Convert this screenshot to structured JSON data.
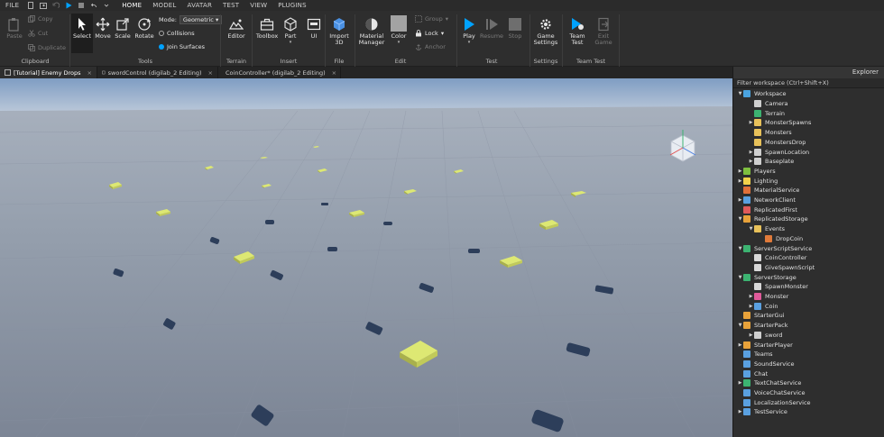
{
  "menu": {
    "file": "FILE",
    "tabs": [
      "HOME",
      "MODEL",
      "AVATAR",
      "TEST",
      "VIEW",
      "PLUGINS"
    ]
  },
  "ribbon": {
    "clipboard": {
      "paste": "Paste",
      "copy": "Copy",
      "cut": "Cut",
      "duplicate": "Duplicate"
    },
    "tools": {
      "select": "Select",
      "move": "Move",
      "scale": "Scale",
      "rotate": "Rotate",
      "mode_label": "Mode:",
      "mode_value": "Geometric",
      "collisions": "Collisions",
      "join_surfaces": "Join Surfaces"
    },
    "terrain": {
      "editor": "Editor"
    },
    "insert": {
      "toolbox": "Toolbox",
      "part": "Part",
      "ui": "UI"
    },
    "file": {
      "import3d_line1": "Import",
      "import3d_line2": "3D"
    },
    "edit": {
      "material_line1": "Material",
      "material_line2": "Manager",
      "color": "Color",
      "group": "Group",
      "lock": "Lock",
      "anchor": "Anchor"
    },
    "test": {
      "play": "Play",
      "resume": "Resume",
      "stop": "Stop"
    },
    "settings": {
      "game_line1": "Game",
      "game_line2": "Settings"
    },
    "teamtest": {
      "team_line1": "Team",
      "team_line2": "Test",
      "exit_line1": "Exit",
      "exit_line2": "Game"
    },
    "groups": {
      "clipboard": "Clipboard",
      "tools": "Tools",
      "terrain": "Terrain",
      "insert": "Insert",
      "file": "File",
      "edit": "Edit",
      "test": "Test",
      "settings": "Settings",
      "team_test": "Team Test"
    }
  },
  "doc_tabs": [
    "[Tutorial] Enemy Drops",
    "swordControl (digilab_2 Editing)",
    "CoinController* (digilab_2 Editing)"
  ],
  "explorer": {
    "title": "Explorer",
    "filter_placeholder": "Filter workspace (Ctrl+Shift+X)",
    "items": [
      {
        "label": "Workspace",
        "level": 0,
        "arrow": "open",
        "icon": "globe-icon",
        "color": "#4aa3df"
      },
      {
        "label": "Camera",
        "level": 1,
        "arrow": "none",
        "icon": "camera-icon",
        "color": "#cfcfcf"
      },
      {
        "label": "Terrain",
        "level": 1,
        "arrow": "none",
        "icon": "terrain-icon",
        "color": "#3cb371"
      },
      {
        "label": "MonsterSpawns",
        "level": 1,
        "arrow": "closed",
        "icon": "folder-icon",
        "color": "#e8c15a"
      },
      {
        "label": "Monsters",
        "level": 1,
        "arrow": "none",
        "icon": "folder-icon",
        "color": "#e8c15a"
      },
      {
        "label": "MonstersDrop",
        "level": 1,
        "arrow": "none",
        "icon": "folder-icon",
        "color": "#e8c15a"
      },
      {
        "label": "SpawnLocation",
        "level": 1,
        "arrow": "closed",
        "icon": "gear-icon",
        "color": "#cfcfcf"
      },
      {
        "label": "Baseplate",
        "level": 1,
        "arrow": "closed",
        "icon": "box-icon",
        "color": "#cfcfcf"
      },
      {
        "label": "Players",
        "level": 0,
        "arrow": "closed",
        "icon": "players-icon",
        "color": "#7fbf3f"
      },
      {
        "label": "Lighting",
        "level": 0,
        "arrow": "closed",
        "icon": "lightbulb-icon",
        "color": "#f2d24b"
      },
      {
        "label": "MaterialService",
        "level": 0,
        "arrow": "none",
        "icon": "material-icon",
        "color": "#e0703a"
      },
      {
        "label": "NetworkClient",
        "level": 0,
        "arrow": "closed",
        "icon": "network-icon",
        "color": "#5aa0e0"
      },
      {
        "label": "ReplicatedFirst",
        "level": 0,
        "arrow": "none",
        "icon": "replicated-icon",
        "color": "#e05a5a"
      },
      {
        "label": "ReplicatedStorage",
        "level": 0,
        "arrow": "open",
        "icon": "storage-icon",
        "color": "#e8a23a"
      },
      {
        "label": "Events",
        "level": 1,
        "arrow": "open",
        "icon": "folder-icon",
        "color": "#e8c15a"
      },
      {
        "label": "DropCoin",
        "level": 2,
        "arrow": "none",
        "icon": "remote-event-icon",
        "color": "#e07a3a"
      },
      {
        "label": "ServerScriptService",
        "level": 0,
        "arrow": "open",
        "icon": "server-script-icon",
        "color": "#3cb371"
      },
      {
        "label": "CoinController",
        "level": 1,
        "arrow": "none",
        "icon": "script-icon",
        "color": "#d8d8d8"
      },
      {
        "label": "GiveSpawnScript",
        "level": 1,
        "arrow": "none",
        "icon": "script-icon",
        "color": "#d8d8d8"
      },
      {
        "label": "ServerStorage",
        "level": 0,
        "arrow": "open",
        "icon": "server-storage-icon",
        "color": "#3cb371"
      },
      {
        "label": "SpawnMonster",
        "level": 1,
        "arrow": "none",
        "icon": "script-icon",
        "color": "#d8d8d8"
      },
      {
        "label": "Monster",
        "level": 1,
        "arrow": "closed",
        "icon": "model-icon",
        "color": "#e05a9a"
      },
      {
        "label": "Coin",
        "level": 1,
        "arrow": "closed",
        "icon": "model-icon",
        "color": "#5aa0e0"
      },
      {
        "label": "StarterGui",
        "level": 0,
        "arrow": "none",
        "icon": "startergui-icon",
        "color": "#e8a23a"
      },
      {
        "label": "StarterPack",
        "level": 0,
        "arrow": "open",
        "icon": "starterpack-icon",
        "color": "#e8a23a"
      },
      {
        "label": "sword",
        "level": 1,
        "arrow": "closed",
        "icon": "tool-icon",
        "color": "#cfcfcf"
      },
      {
        "label": "StarterPlayer",
        "level": 0,
        "arrow": "closed",
        "icon": "starterplayer-icon",
        "color": "#e8a23a"
      },
      {
        "label": "Teams",
        "level": 0,
        "arrow": "none",
        "icon": "teams-icon",
        "color": "#5aa0e0"
      },
      {
        "label": "SoundService",
        "level": 0,
        "arrow": "none",
        "icon": "sound-icon",
        "color": "#5aa0e0"
      },
      {
        "label": "Chat",
        "level": 0,
        "arrow": "none",
        "icon": "chat-icon",
        "color": "#5aa0e0"
      },
      {
        "label": "TextChatService",
        "level": 0,
        "arrow": "closed",
        "icon": "textchat-icon",
        "color": "#3cb371"
      },
      {
        "label": "VoiceChatService",
        "level": 0,
        "arrow": "none",
        "icon": "voicechat-icon",
        "color": "#5aa0e0"
      },
      {
        "label": "LocalizationService",
        "level": 0,
        "arrow": "none",
        "icon": "localization-icon",
        "color": "#5aa0e0"
      },
      {
        "label": "TestService",
        "level": 0,
        "arrow": "closed",
        "icon": "test-service-icon",
        "color": "#5aa0e0"
      }
    ]
  },
  "colors": {
    "accent": "#00a2ff",
    "sky_top": "#8aa6c9",
    "ground": "#8d96a6",
    "coin": "#dde873",
    "shadow": "#2d3e5a"
  }
}
